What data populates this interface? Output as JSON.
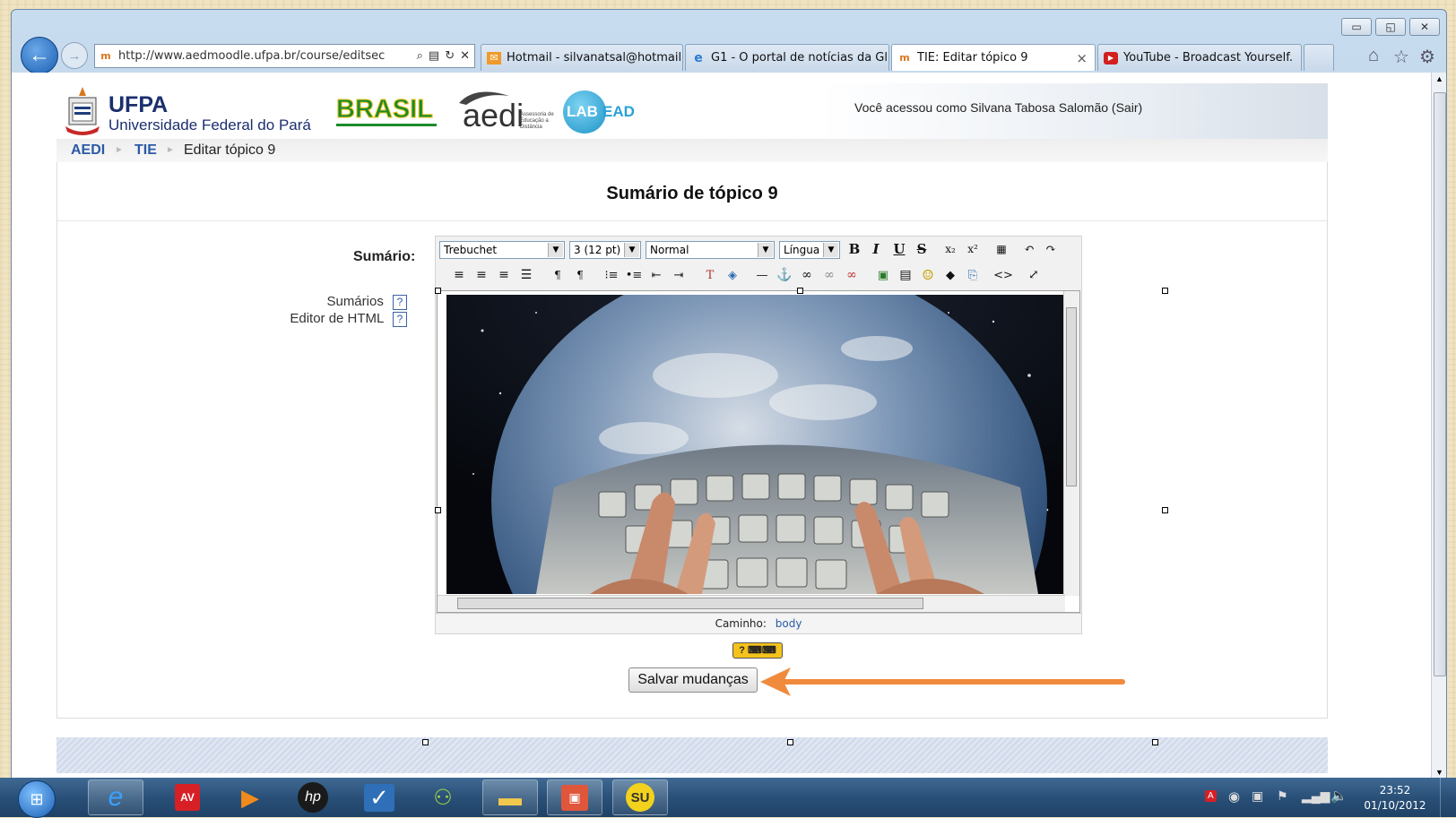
{
  "browser": {
    "address_url": "http://www.aedmoodle.ufpa.br/course/editsec",
    "tabs": [
      {
        "label": "Hotmail - silvanatsal@hotmail...."
      },
      {
        "label": "G1 - O portal de notícias da Gl..."
      },
      {
        "label": "TIE: Editar tópico 9",
        "close": "×"
      },
      {
        "label": "YouTube - Broadcast Yourself."
      }
    ]
  },
  "header": {
    "ufpa_title": "UFPA",
    "ufpa_subtitle": "Universidade Federal do Pará",
    "brasil_logo": "BRASIL",
    "aedi_logo": "aedi",
    "aedi_tag": "Assessoria de Educação a Distância",
    "labead_logo_a": "LAB",
    "labead_logo_b": "EAD",
    "login_info": "Você acessou como Silvana Tabosa Salomão (Sair)"
  },
  "breadcrumb": {
    "items": [
      "AEDI",
      "TIE",
      "Editar tópico 9"
    ],
    "separator": "►"
  },
  "page": {
    "heading": "Sumário de tópico 9",
    "field_label": "Sumário:",
    "help_links": [
      "Sumários",
      "Editor de HTML"
    ],
    "help_icon": "?",
    "path_label": "Caminho:",
    "path_value": "body",
    "save_button": "Salvar mudanças"
  },
  "editor_toolbar": {
    "font_family": "Trebuchet",
    "font_size": "3 (12 pt)",
    "format": "Normal",
    "language": "Língua"
  },
  "taskbar": {
    "time": "23:52",
    "date": "01/10/2012"
  },
  "colors": {
    "arrow": "#f08a3c",
    "link": "#2b5aa7",
    "taskbar": "#2a5078"
  }
}
